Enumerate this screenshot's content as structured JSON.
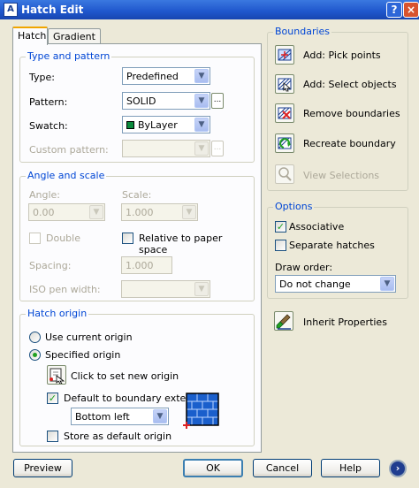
{
  "window": {
    "title": "Hatch Edit",
    "app_icon": "A",
    "help_glyph": "?",
    "close_glyph": "×"
  },
  "tabs": [
    {
      "label": "Hatch",
      "active": true
    },
    {
      "label": "Gradient",
      "active": false
    }
  ],
  "type_and_pattern": {
    "group_label": "Type and pattern",
    "type_label": "Type:",
    "type_value": "Predefined",
    "pattern_label": "Pattern:",
    "pattern_value": "SOLID",
    "pattern_browse": "...",
    "swatch_label": "Swatch:",
    "swatch_value": "ByLayer",
    "swatch_color": "#0a8a3c",
    "custom_pattern_label": "Custom pattern:",
    "custom_pattern_value": "",
    "custom_browse": "..."
  },
  "angle_and_scale": {
    "group_label": "Angle and scale",
    "angle_label": "Angle:",
    "angle_value": "0.00",
    "scale_label": "Scale:",
    "scale_value": "1.000",
    "double_label": "Double",
    "double_checked": false,
    "relative_label": "Relative to paper space",
    "relative_checked": false,
    "spacing_label": "Spacing:",
    "spacing_value": "1.000",
    "iso_pen_label": "ISO pen width:",
    "iso_pen_value": ""
  },
  "hatch_origin": {
    "group_label": "Hatch origin",
    "use_current_label": "Use current origin",
    "use_current_selected": false,
    "specified_label": "Specified origin",
    "specified_selected": true,
    "click_set_label": "Click to set new origin",
    "default_extents_label": "Default to boundary extents",
    "default_extents_checked": true,
    "extents_position": "Bottom left",
    "store_default_label": "Store as default origin",
    "store_default_checked": false
  },
  "boundaries": {
    "group_label": "Boundaries",
    "add_pick_points": "Add: Pick points",
    "add_select_objects": "Add: Select objects",
    "remove_boundaries": "Remove boundaries",
    "recreate_boundary": "Recreate boundary",
    "view_selections": "View Selections"
  },
  "options": {
    "group_label": "Options",
    "associative_label": "Associative",
    "associative_checked": true,
    "separate_label": "Separate hatches",
    "separate_checked": false,
    "draw_order_label": "Draw order:",
    "draw_order_value": "Do not change"
  },
  "inherit_properties": "Inherit Properties",
  "footer": {
    "preview": "Preview",
    "ok": "OK",
    "cancel": "Cancel",
    "help": "Help",
    "more_glyph": "›"
  },
  "colors": {
    "accent_blue": "#0046d5",
    "title_blue": "#1f56cc",
    "check_green": "#21a121",
    "face": "#ece9d8"
  }
}
